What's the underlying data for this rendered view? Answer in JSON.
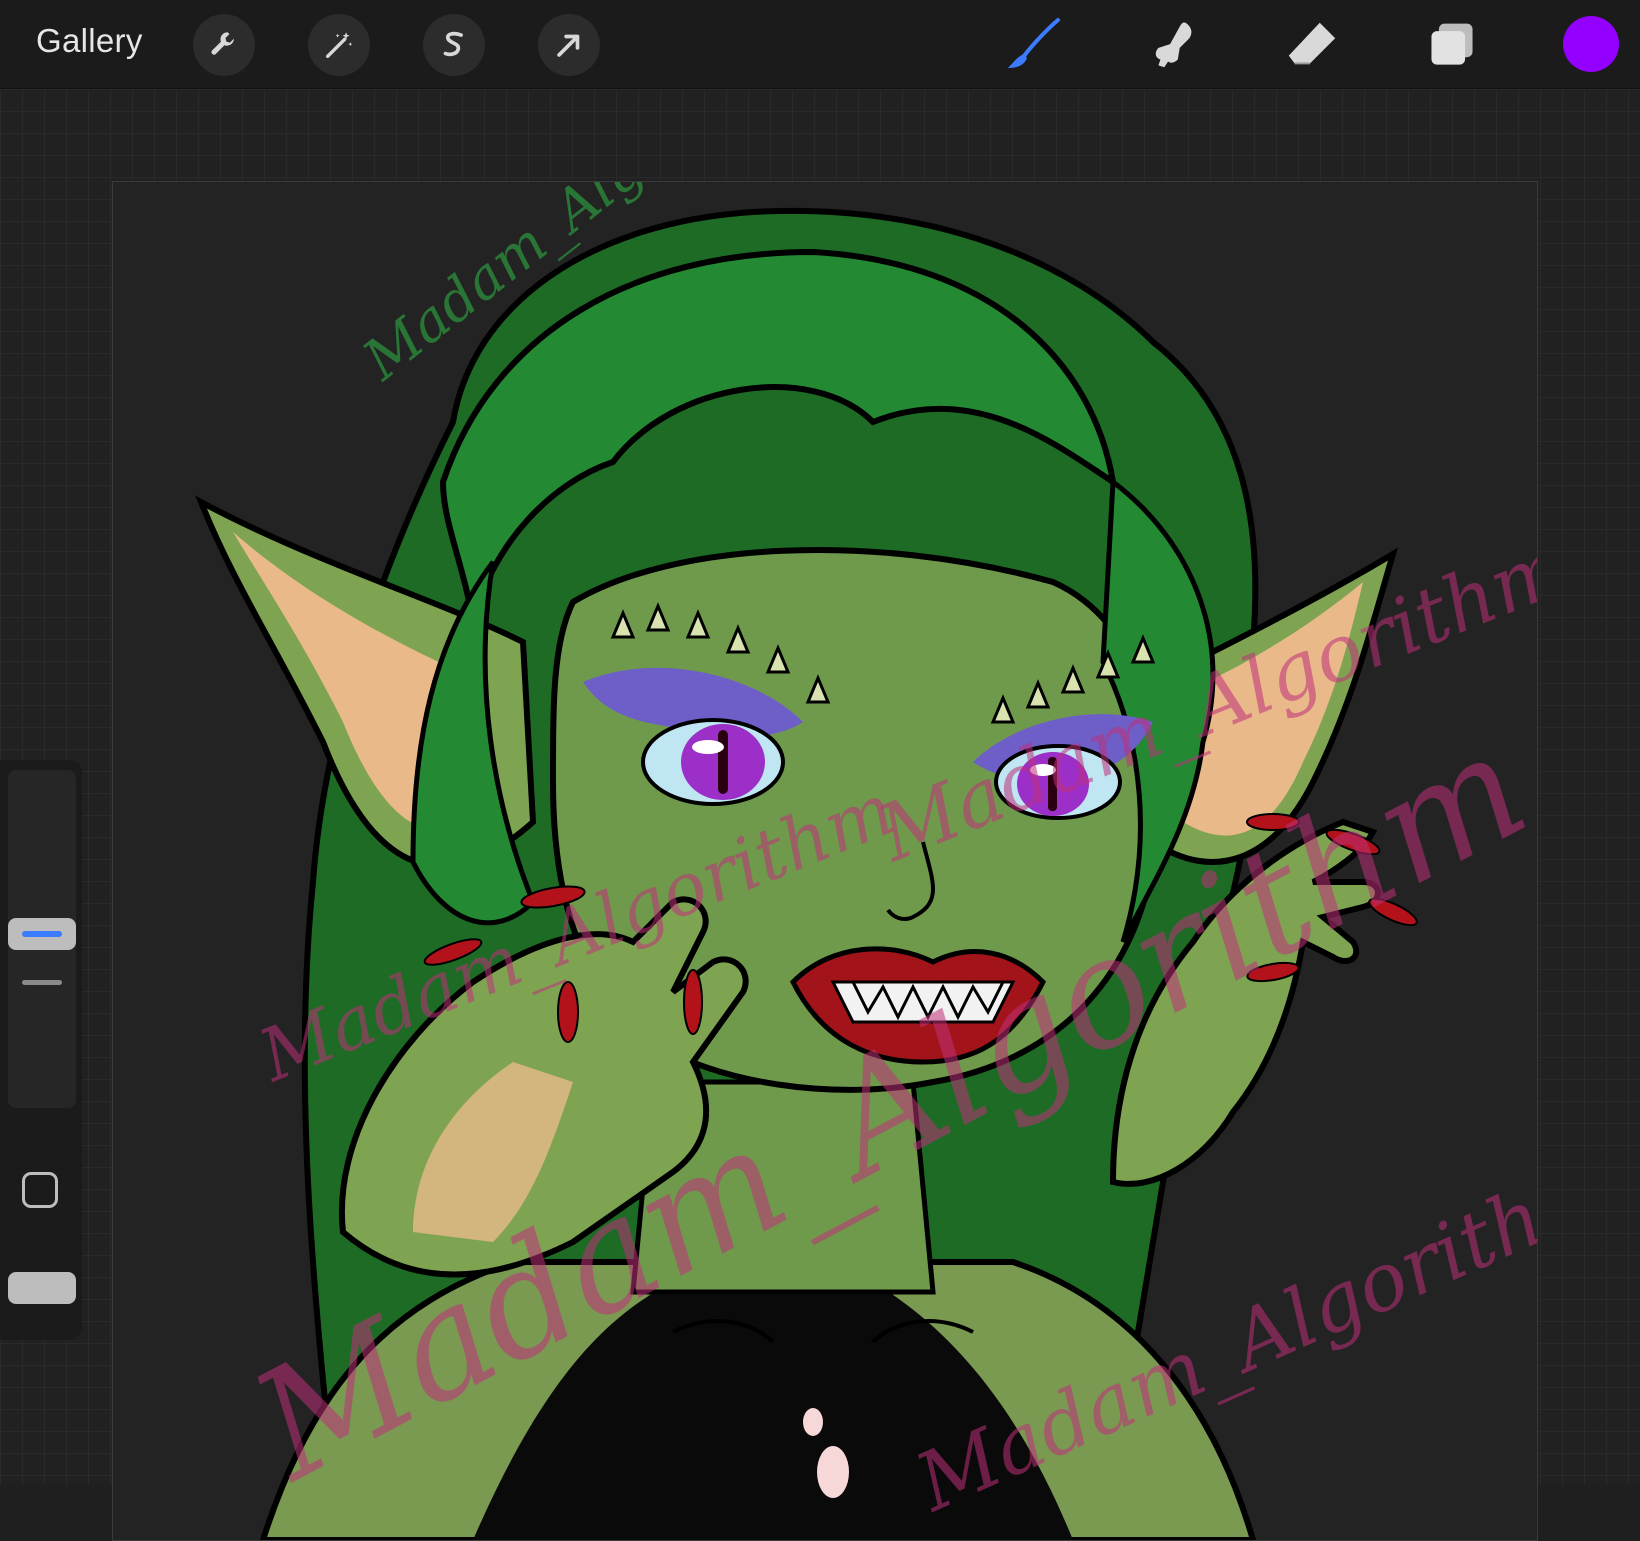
{
  "toolbar": {
    "gallery_label": "Gallery",
    "left_tools": [
      "wrench-icon",
      "magic-wand-icon",
      "selection-s-icon",
      "transform-arrow-icon"
    ],
    "right_tools": [
      "brush-icon",
      "smudge-icon",
      "eraser-icon",
      "layers-icon"
    ],
    "active_tool": "brush-icon",
    "current_color": "#9400ff",
    "accent_color": "#3b7bff"
  },
  "sidebar": {
    "controls": [
      "brush-size-slider",
      "opacity-slider",
      "modify-button",
      "undo-button"
    ]
  },
  "canvas": {
    "watermark_text": "Madam_Algorithm",
    "colors": {
      "skin": "#6f9a4c",
      "hair": "#1f7a2a",
      "lips": "#a3141a",
      "eyes": "#9b2fc7",
      "top": "#0a0a0a"
    }
  }
}
